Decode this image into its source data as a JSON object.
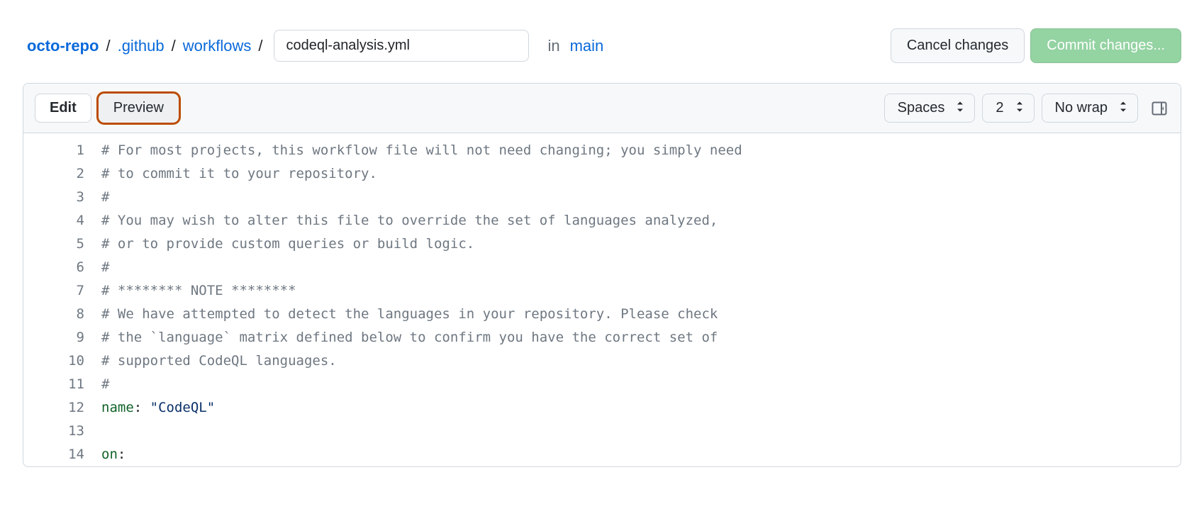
{
  "breadcrumb": {
    "repo": "octo-repo",
    "path1": ".github",
    "path2": "workflows",
    "sep": "/"
  },
  "filename": "codeql-analysis.yml",
  "in_label": "in",
  "branch": "main",
  "buttons": {
    "cancel": "Cancel changes",
    "commit": "Commit changes..."
  },
  "tabs": {
    "edit": "Edit",
    "preview": "Preview"
  },
  "selects": {
    "indent": "Spaces",
    "size": "2",
    "wrap": "No wrap"
  },
  "code_lines": [
    {
      "n": "1",
      "type": "comment",
      "text": "# For most projects, this workflow file will not need changing; you simply need"
    },
    {
      "n": "2",
      "type": "comment",
      "text": "# to commit it to your repository."
    },
    {
      "n": "3",
      "type": "comment",
      "text": "#"
    },
    {
      "n": "4",
      "type": "comment",
      "text": "# You may wish to alter this file to override the set of languages analyzed,"
    },
    {
      "n": "5",
      "type": "comment",
      "text": "# or to provide custom queries or build logic."
    },
    {
      "n": "6",
      "type": "comment",
      "text": "#"
    },
    {
      "n": "7",
      "type": "comment",
      "text": "# ******** NOTE ********"
    },
    {
      "n": "8",
      "type": "comment",
      "text": "# We have attempted to detect the languages in your repository. Please check"
    },
    {
      "n": "9",
      "type": "comment",
      "text": "# the `language` matrix defined below to confirm you have the correct set of"
    },
    {
      "n": "10",
      "type": "comment",
      "text": "# supported CodeQL languages."
    },
    {
      "n": "11",
      "type": "comment",
      "text": "#"
    },
    {
      "n": "12",
      "type": "kv",
      "key": "name",
      "sep": ": ",
      "value": "\"CodeQL\""
    },
    {
      "n": "13",
      "type": "blank",
      "text": ""
    },
    {
      "n": "14",
      "type": "kv",
      "key": "on",
      "sep": ":",
      "value": ""
    }
  ]
}
